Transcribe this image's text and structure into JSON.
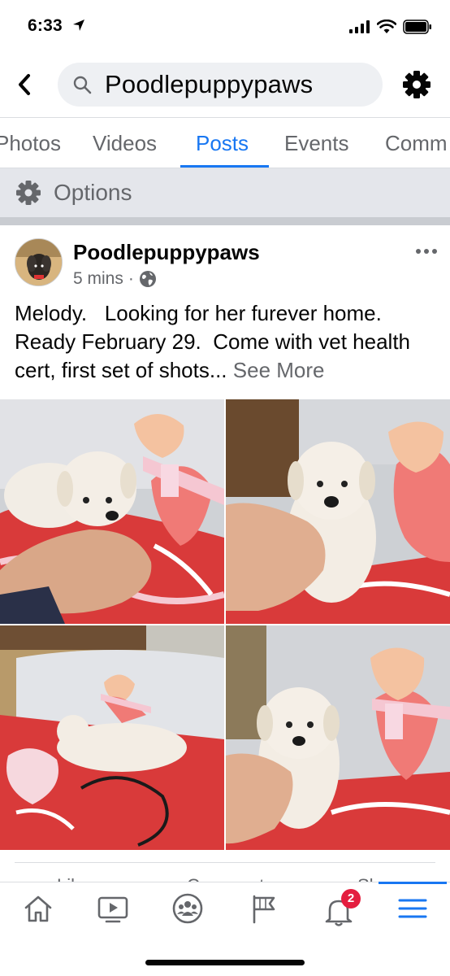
{
  "status": {
    "time": "6:33"
  },
  "search": {
    "query": "Poodlepuppypaws"
  },
  "tabs": [
    {
      "label": "Photos"
    },
    {
      "label": "Videos"
    },
    {
      "label": "Posts",
      "active": true
    },
    {
      "label": "Events"
    },
    {
      "label": "Comm"
    }
  ],
  "options": {
    "label": "Options"
  },
  "post": {
    "author": "Poodlepuppypaws",
    "time": "5 mins",
    "separator": "·",
    "text": "Melody.   Looking for her furever home.  Ready February 29.  Come with vet health cert, first set of shots...",
    "see_more": "See More"
  },
  "actions": {
    "like": "Like",
    "comment": "Comment",
    "share": "Share"
  },
  "tabbar": {
    "items": [
      "home-icon",
      "video-icon",
      "groups-icon",
      "pages-flag-icon",
      "notifications-icon",
      "menu-icon"
    ],
    "notification_count": "2"
  },
  "colors": {
    "accent": "#1877f2",
    "badge": "#e41e3f",
    "muted": "#65676b"
  }
}
